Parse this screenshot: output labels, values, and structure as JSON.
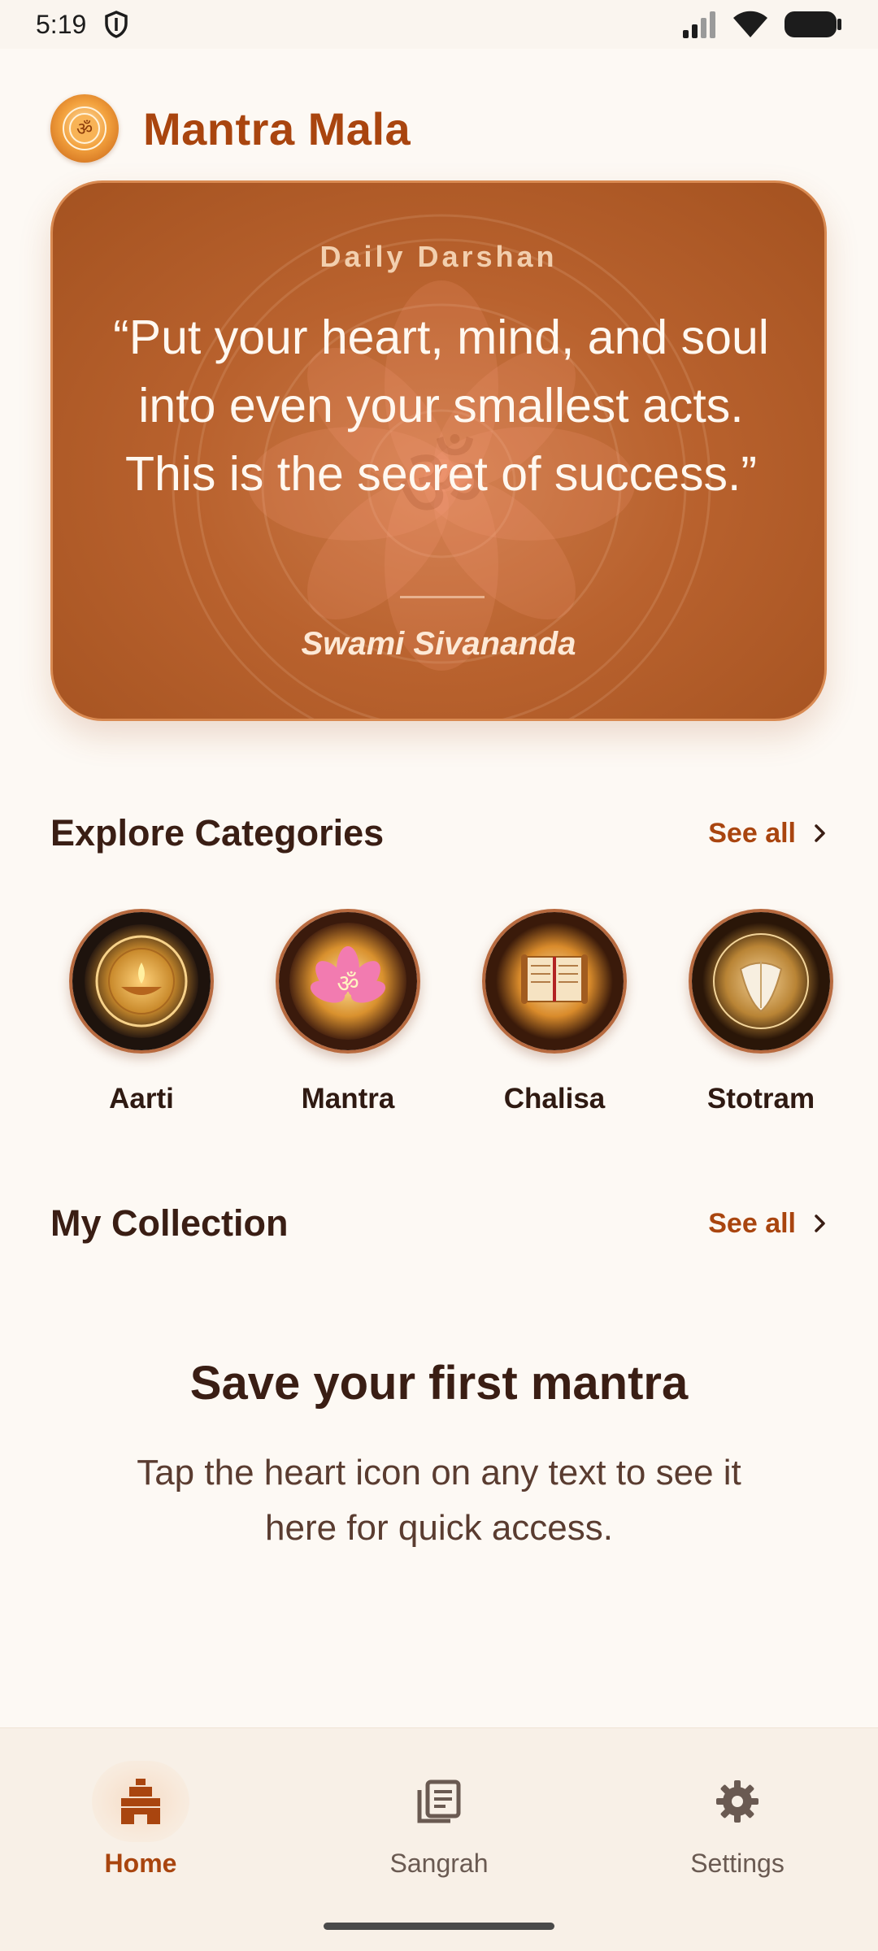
{
  "status_bar": {
    "time": "5:19"
  },
  "header": {
    "app_title": "Mantra Mala",
    "logo_icon": "om-icon"
  },
  "daily_card": {
    "label": "Daily Darshan",
    "quote": "“Put your heart, mind, and soul into even your smallest acts. This is the secret of success.”",
    "author": "Swami Sivananda"
  },
  "categories_section": {
    "title": "Explore Categories",
    "see_all": "See all",
    "items": [
      {
        "label": "Aarti",
        "icon": "diya-icon"
      },
      {
        "label": "Mantra",
        "icon": "om-lotus-icon"
      },
      {
        "label": "Chalisa",
        "icon": "scroll-icon"
      },
      {
        "label": "Stotram",
        "icon": "conch-icon"
      }
    ]
  },
  "collection_section": {
    "title": "My Collection",
    "see_all": "See all",
    "empty_title": "Save your first mantra",
    "empty_desc": "Tap the heart icon on any text to see it here for quick access."
  },
  "bottom_nav": {
    "items": [
      {
        "label": "Home",
        "icon": "temple-icon",
        "active": true
      },
      {
        "label": "Sangrah",
        "icon": "library-icon",
        "active": false
      },
      {
        "label": "Settings",
        "icon": "gear-icon",
        "active": false
      }
    ]
  },
  "colors": {
    "accent": "#a9450f",
    "card": "#b9622e",
    "background": "#fdf9f4",
    "text": "#3a1e14"
  }
}
